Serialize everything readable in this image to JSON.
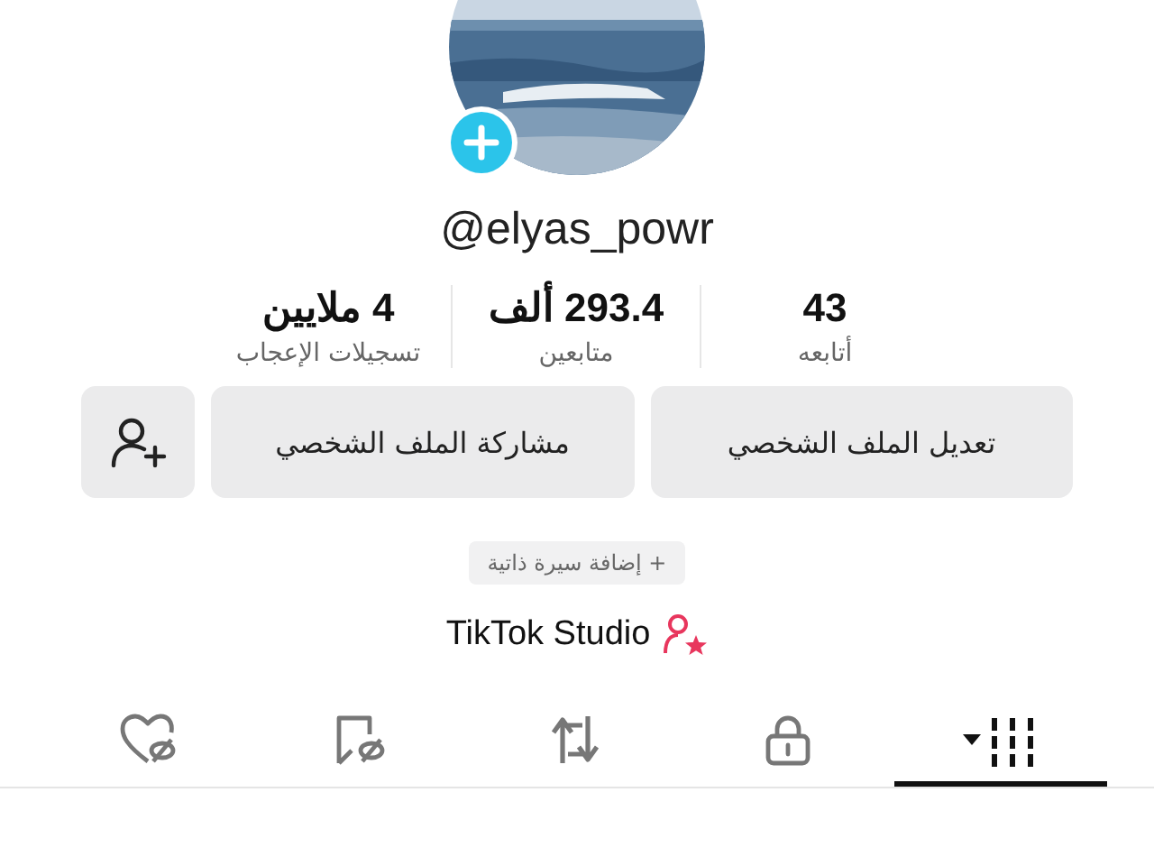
{
  "profile": {
    "username": "@elyas_powr"
  },
  "stats": [
    {
      "value": "43",
      "label": "أتابعه"
    },
    {
      "value": "293.4 ألف",
      "label": "متابعين"
    },
    {
      "value": "4 ملايين",
      "label": "تسجيلات الإعجاب"
    }
  ],
  "buttons": [
    {
      "kind": "text",
      "label": "تعديل الملف الشخصي"
    },
    {
      "kind": "text",
      "label": "مشاركة الملف الشخصي"
    },
    {
      "kind": "add-friend"
    }
  ],
  "bio_button": {
    "label": "+ إضافة سيرة ذاتية"
  },
  "studio_link": {
    "label": "TikTok Studio"
  },
  "tabs": [
    {
      "kind": "videos",
      "selected": true
    },
    {
      "kind": "private",
      "selected": false
    },
    {
      "kind": "reposts",
      "selected": false
    },
    {
      "kind": "favorites",
      "selected": false
    },
    {
      "kind": "liked",
      "selected": false
    }
  ]
}
